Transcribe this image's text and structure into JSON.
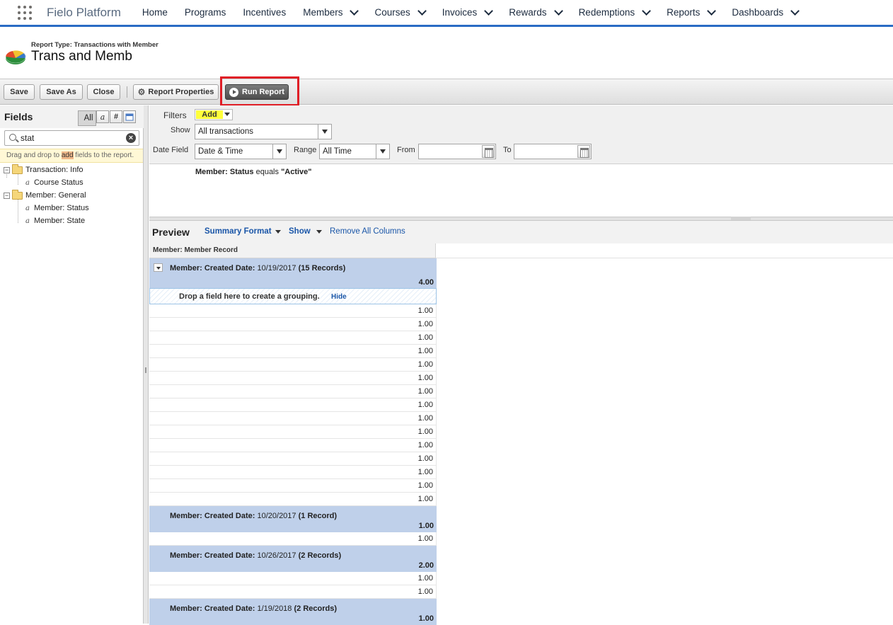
{
  "nav": {
    "app_name": "Fielo Platform",
    "items": [
      {
        "label": "Home",
        "dropdown": false
      },
      {
        "label": "Programs",
        "dropdown": false
      },
      {
        "label": "Incentives",
        "dropdown": false
      },
      {
        "label": "Members",
        "dropdown": true
      },
      {
        "label": "Courses",
        "dropdown": true
      },
      {
        "label": "Invoices",
        "dropdown": true
      },
      {
        "label": "Rewards",
        "dropdown": true
      },
      {
        "label": "Redemptions",
        "dropdown": true
      },
      {
        "label": "Reports",
        "dropdown": true
      },
      {
        "label": "Dashboards",
        "dropdown": true
      }
    ]
  },
  "header": {
    "report_type": "Report Type: Transactions with Member",
    "title": "Trans and Memb"
  },
  "toolbar": {
    "save": "Save",
    "save_as": "Save As",
    "close": "Close",
    "properties": "Report Properties",
    "run": "Run Report"
  },
  "fields": {
    "title": "Fields",
    "filters": {
      "all": "All",
      "text": "a",
      "number": "#"
    },
    "search_value": "stat",
    "drag_tip_before": "Drag and drop to ",
    "drag_tip_mark": "add",
    "drag_tip_after": " fields to the report.",
    "tree": {
      "group1": {
        "label": "Transaction: Info",
        "items": [
          "Course Status"
        ]
      },
      "group2": {
        "label": "Member: General",
        "items": [
          "Member: Status",
          "Member: State"
        ]
      }
    }
  },
  "filters": {
    "filters_label": "Filters",
    "add_label": "Add",
    "show_label": "Show",
    "show_value": "All transactions",
    "date_field_label": "Date Field",
    "date_field_value": "Date & Time",
    "range_label": "Range",
    "range_value": "All Time",
    "from_label": "From",
    "to_label": "To",
    "criteria_field": "Member: Status",
    "criteria_op": " equals ",
    "criteria_value": "\"Active\""
  },
  "preview": {
    "title": "Preview",
    "format": "Summary Format",
    "show": "Show",
    "remove": "Remove All Columns",
    "column": "Member: Member Record",
    "dropzone_text": "Drop a field here to create a grouping.",
    "hide": "Hide",
    "groups": [
      {
        "label": "Member: Created Date:",
        "date": "10/19/2017",
        "count": "(15 Records)",
        "total": "4.00",
        "rows": [
          "1.00",
          "1.00",
          "1.00",
          "1.00",
          "1.00",
          "1.00",
          "1.00",
          "1.00",
          "1.00",
          "1.00",
          "1.00",
          "1.00",
          "1.00",
          "1.00",
          "1.00"
        ]
      },
      {
        "label": "Member: Created Date:",
        "date": "10/20/2017",
        "count": "(1 Record)",
        "total": "1.00",
        "rows": [
          "1.00"
        ]
      },
      {
        "label": "Member: Created Date:",
        "date": "10/26/2017",
        "count": "(2 Records)",
        "total": "2.00",
        "rows": [
          "1.00",
          "1.00"
        ]
      },
      {
        "label": "Member: Created Date:",
        "date": "1/19/2018",
        "count": "(2 Records)",
        "total": "1.00",
        "rows": []
      }
    ]
  },
  "colors": {
    "nav_accent": "#2a6cc4",
    "group_band": "#bfd0ea",
    "highlight": "#e01e26",
    "link": "#1a56a8"
  }
}
